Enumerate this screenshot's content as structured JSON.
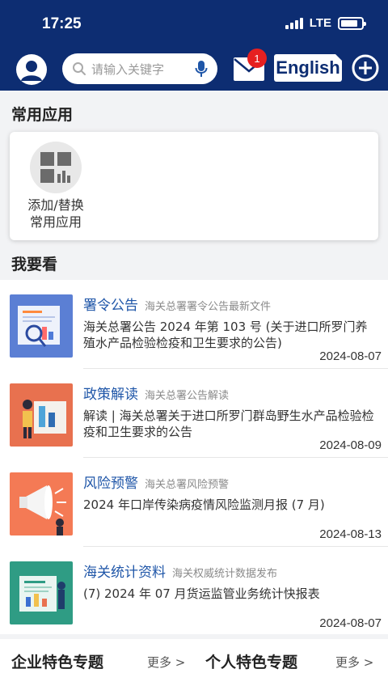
{
  "status": {
    "time": "17:25",
    "network": "LTE"
  },
  "header": {
    "search_placeholder": "请输入关键字",
    "mail_badge": "1",
    "language_button": "English"
  },
  "common_apps": {
    "title": "常用应用",
    "items": [
      {
        "label_line1": "添加/替换",
        "label_line2": "常用应用",
        "icon": "grid-chart-icon"
      }
    ]
  },
  "watch": {
    "title": "我要看",
    "items": [
      {
        "category": "署令公告",
        "subtitle": "海关总署署令公告最新文件",
        "text": "海关总署公告 2024 年第 103 号 (关于进口所罗门养殖水产品检验检疫和卫生要求的公告)",
        "date": "2024-08-07"
      },
      {
        "category": "政策解读",
        "subtitle": "海关总署公告解读",
        "text": "解读 | 海关总署关于进口所罗门群岛野生水产品检验检疫和卫生要求的公告",
        "date": "2024-08-09"
      },
      {
        "category": "风险预警",
        "subtitle": "海关总署风险预警",
        "text": "2024 年口岸传染病疫情风险监测月报 (7 月)",
        "date": "2024-08-13"
      },
      {
        "category": "海关统计资料",
        "subtitle": "海关权威统计数据发布",
        "text": "(7) 2024 年 07 月货运监管业务统计快报表",
        "date": "2024-08-07"
      }
    ]
  },
  "bottom": {
    "enterprise_title": "企业特色专题",
    "enterprise_more": "更多 >",
    "personal_title": "个人特色专题",
    "personal_more": "更多 >"
  },
  "colors": {
    "brand": "#0d2d72",
    "link": "#1f56a8",
    "badge": "#e62020"
  }
}
